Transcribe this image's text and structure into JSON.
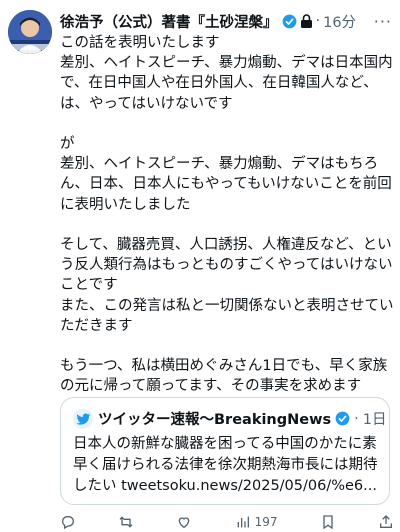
{
  "post": {
    "author_name": "徐浩予（公式）著書『土砂涅槃』",
    "separator": "·",
    "time": "16分",
    "more_label": "···",
    "body": "この話を表明いたします\n差別、ヘイトスピーチ、暴力煽動、デマは日本国内で、在日中国人や在日外国人、在日韓国人など、は、やってはいけないです\n\nが\n差別、ヘイトスピーチ、暴力煽動、デマはもちろん、日本、日本人にもやってもいけないことを前回に表明いたしました\n\nそして、臓器売買、人口誘拐、人権違反など、という反人類行為はもっとものすごくやってはいけないことです\nまた、この発言は私と一切関係ないと表明させていただきます\n\nもう一つ、私は横田めぐみさん1日でも、早く家族の元に帰って願ってます、その事実を求めます"
  },
  "quote": {
    "author_name": "ツイッター速報〜BreakingNews",
    "separator": "·",
    "time": "1日",
    "text": "日本人の新鮮な臓器を困ってる中国のかたに素早く届けられる法律を徐次期熱海市長には期待したい tweetsoku.news/2025/05/06/%e6..."
  },
  "actions": {
    "views": "197"
  },
  "colors": {
    "verified": "#1d9bf0",
    "secondary_text": "#536471",
    "border": "#cfd9de"
  },
  "icons": [
    "avatar",
    "verified-badge-icon",
    "lock-icon",
    "more-icon",
    "reply-icon",
    "retweet-icon",
    "like-icon",
    "views-icon",
    "bookmark-icon",
    "share-icon"
  ]
}
